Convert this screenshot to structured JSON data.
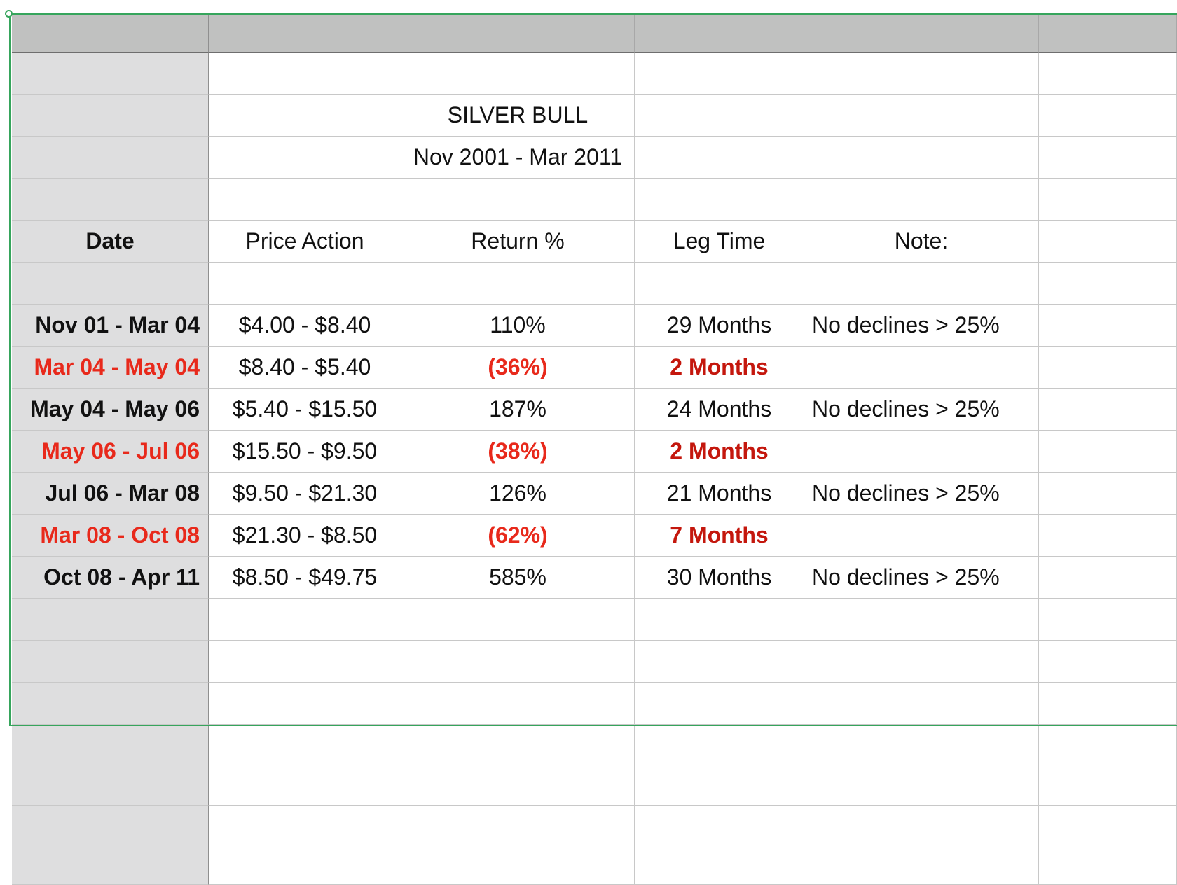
{
  "spreadsheet": {
    "title": "SILVER BULL",
    "period": "Nov 2001 - Mar 2011",
    "headers": {
      "date": "Date",
      "price_action": "Price Action",
      "return_pct": "Return %",
      "leg_time": "Leg Time",
      "note": "Note:"
    },
    "rows": [
      {
        "date": "Nov 01 - Mar 04",
        "price_action": "$4.00 - $8.40",
        "return_pct": "110%",
        "leg_time": "29 Months",
        "note": "No declines > 25%",
        "decline": false
      },
      {
        "date": "Mar 04 - May 04",
        "price_action": "$8.40 - $5.40",
        "return_pct": "(36%)",
        "leg_time": "2 Months",
        "note": "",
        "decline": true
      },
      {
        "date": "May 04 - May 06",
        "price_action": "$5.40 - $15.50",
        "return_pct": "187%",
        "leg_time": "24 Months",
        "note": "No declines > 25%",
        "decline": false
      },
      {
        "date": "May 06 - Jul 06",
        "price_action": "$15.50 - $9.50",
        "return_pct": "(38%)",
        "leg_time": "2 Months",
        "note": "",
        "decline": true
      },
      {
        "date": "Jul 06 - Mar 08",
        "price_action": "$9.50 - $21.30",
        "return_pct": "126%",
        "leg_time": "21 Months",
        "note": "No declines > 25%",
        "decline": false
      },
      {
        "date": "Mar 08 - Oct 08",
        "price_action": " $21.30 - $8.50",
        "return_pct": "(62%)",
        "leg_time": "7 Months",
        "note": "",
        "decline": true
      },
      {
        "date": "Oct 08 - Apr 11",
        "price_action": "$8.50 - $49.75",
        "return_pct": "585%",
        "leg_time": "30 Months",
        "note": "No declines > 25%",
        "decline": false
      }
    ],
    "colors": {
      "decline_date": "#e8291b",
      "decline_value": "#c4170d",
      "header_band": "#c0c1c0",
      "row_header_column": "#dededf",
      "selection_border": "#36a55c"
    }
  }
}
